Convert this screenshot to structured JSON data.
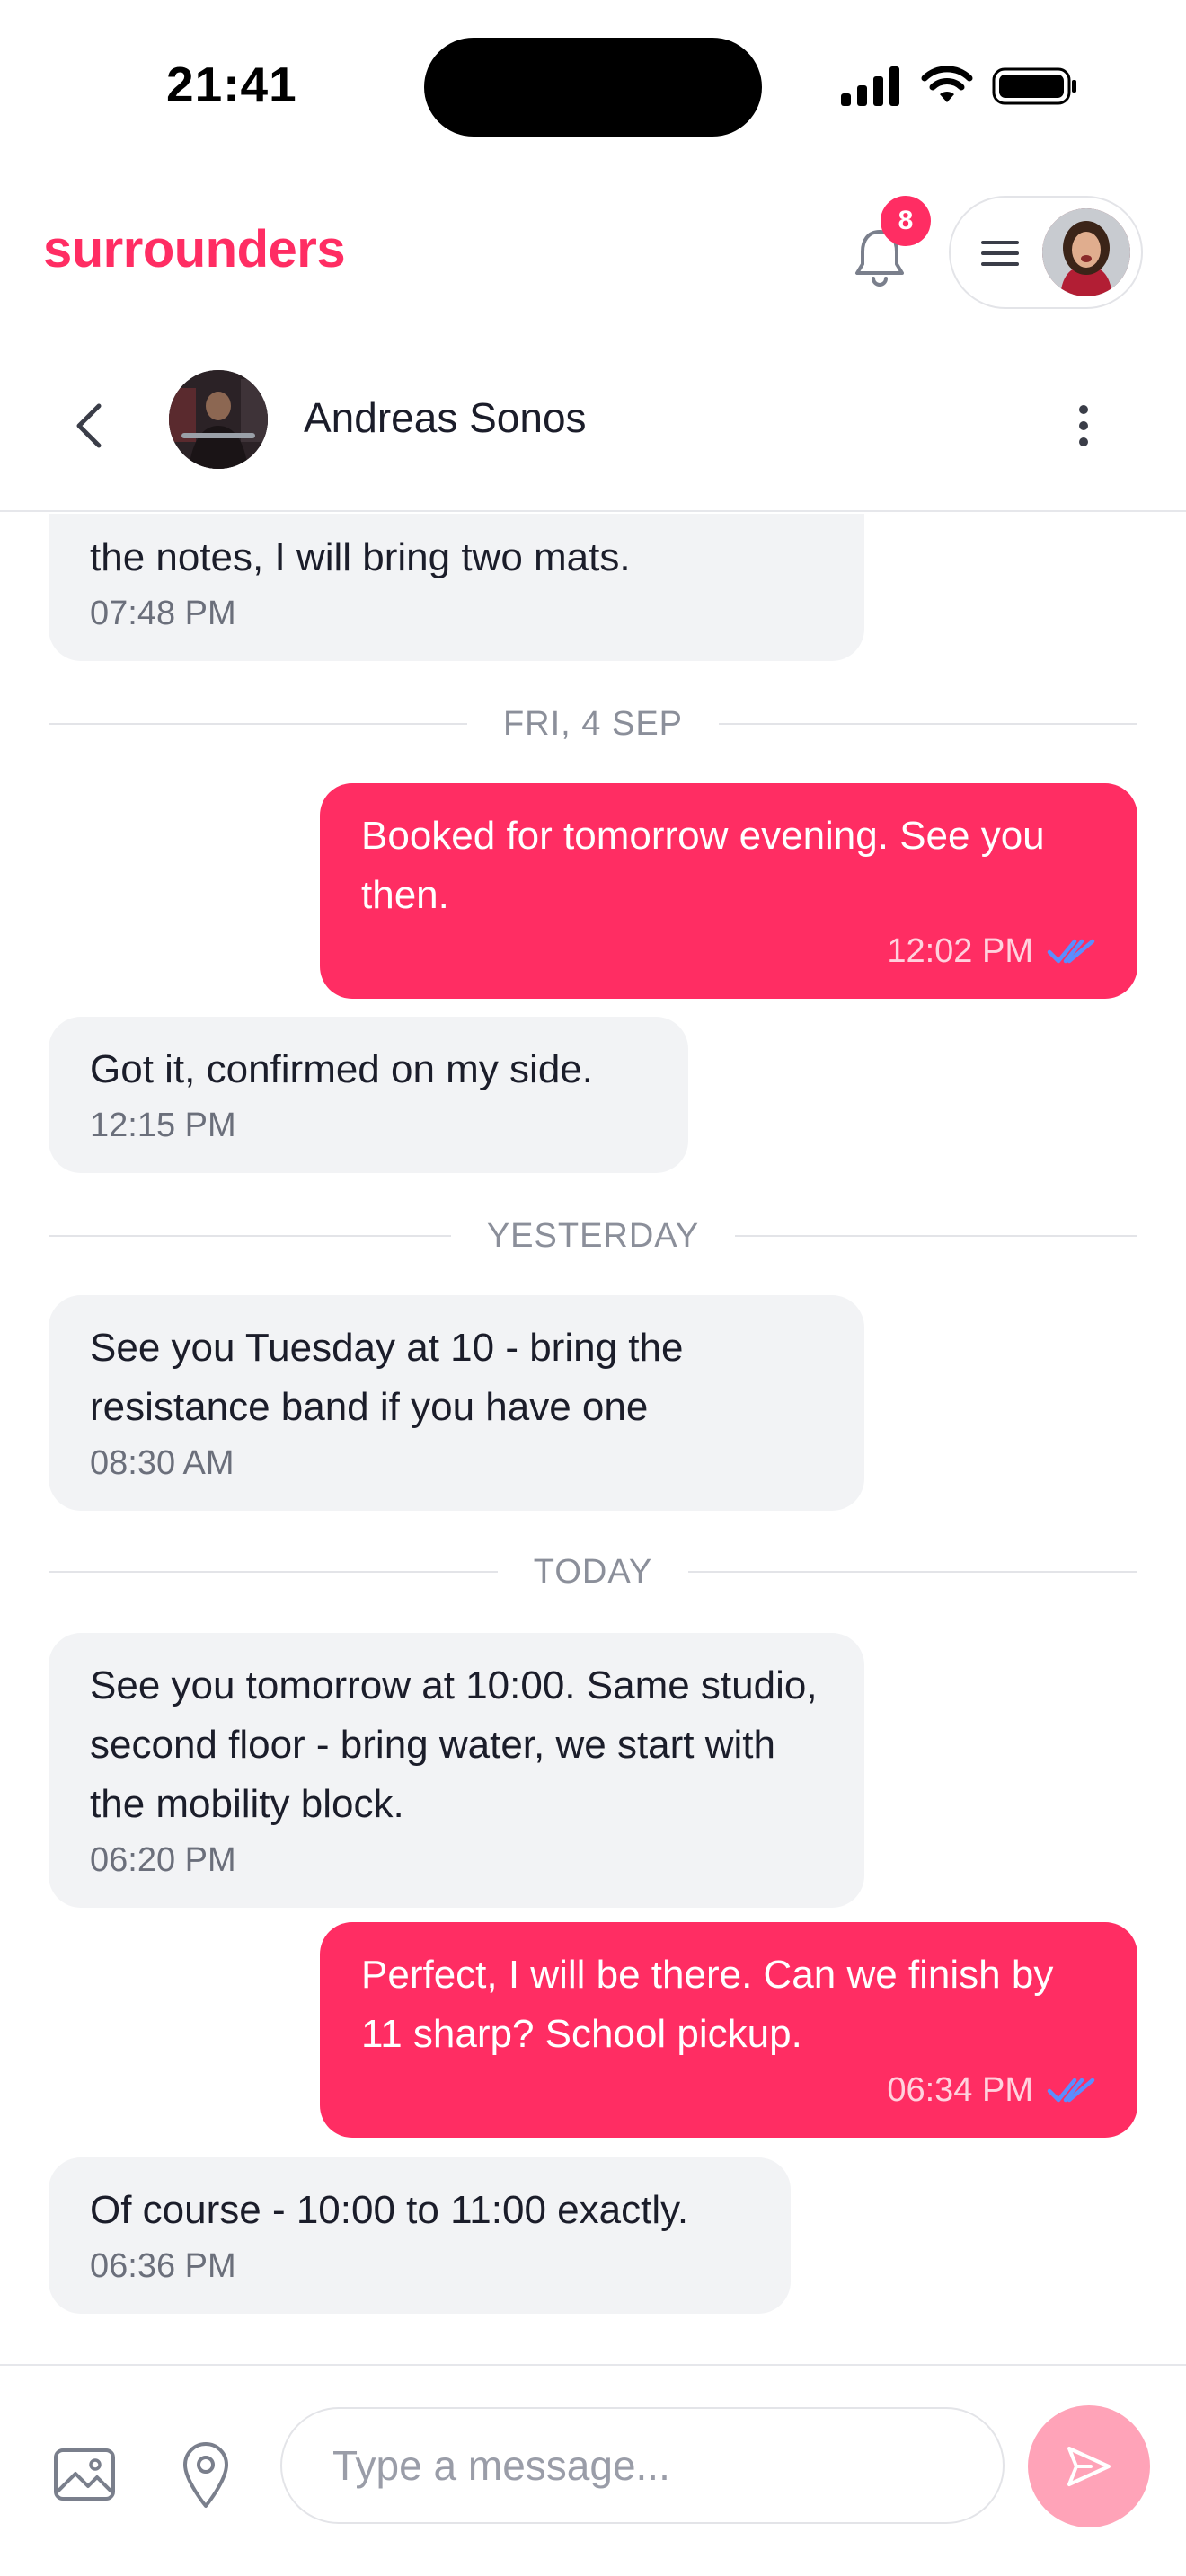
{
  "status_bar": {
    "time": "21:41"
  },
  "app_header": {
    "brand": "surrounders",
    "notification_count": "8",
    "brand_color": "#ff2d63"
  },
  "chat_header": {
    "contact_name": "Andreas Sonos"
  },
  "messages": [
    {
      "direction": "in",
      "text": "the notes, I will bring two mats.",
      "time": "07:48 PM"
    },
    {
      "type": "separator",
      "label": "FRI, 4 SEP"
    },
    {
      "direction": "out",
      "text": "Booked for tomorrow evening. See you then.",
      "time": "12:02 PM",
      "status": "read"
    },
    {
      "direction": "in",
      "text": "Got it, confirmed on my side.",
      "time": "12:15 PM"
    },
    {
      "type": "separator",
      "label": "YESTERDAY"
    },
    {
      "direction": "in",
      "text": "See you Tuesday at 10 - bring the resistance band if you have one",
      "time": "08:30 AM"
    },
    {
      "type": "separator",
      "label": "TODAY"
    },
    {
      "direction": "in",
      "text": "See you tomorrow at 10:00. Same studio, second floor - bring water, we start with the mobility block.",
      "time": "06:20 PM"
    },
    {
      "direction": "out",
      "text": "Perfect, I will be there. Can we finish by 11 sharp? School pickup.",
      "time": "06:34 PM",
      "status": "read"
    },
    {
      "direction": "in",
      "text": "Of course - 10:00 to 11:00 exactly.",
      "time": "06:36 PM"
    }
  ],
  "composer": {
    "placeholder": "Type a message..."
  },
  "icons": {
    "bell": "bell-icon",
    "menu": "hamburger-icon",
    "back": "chevron-left-icon",
    "more": "more-vertical-icon",
    "read": "double-check-icon",
    "image": "image-icon",
    "location": "location-pin-icon",
    "send": "send-icon"
  }
}
